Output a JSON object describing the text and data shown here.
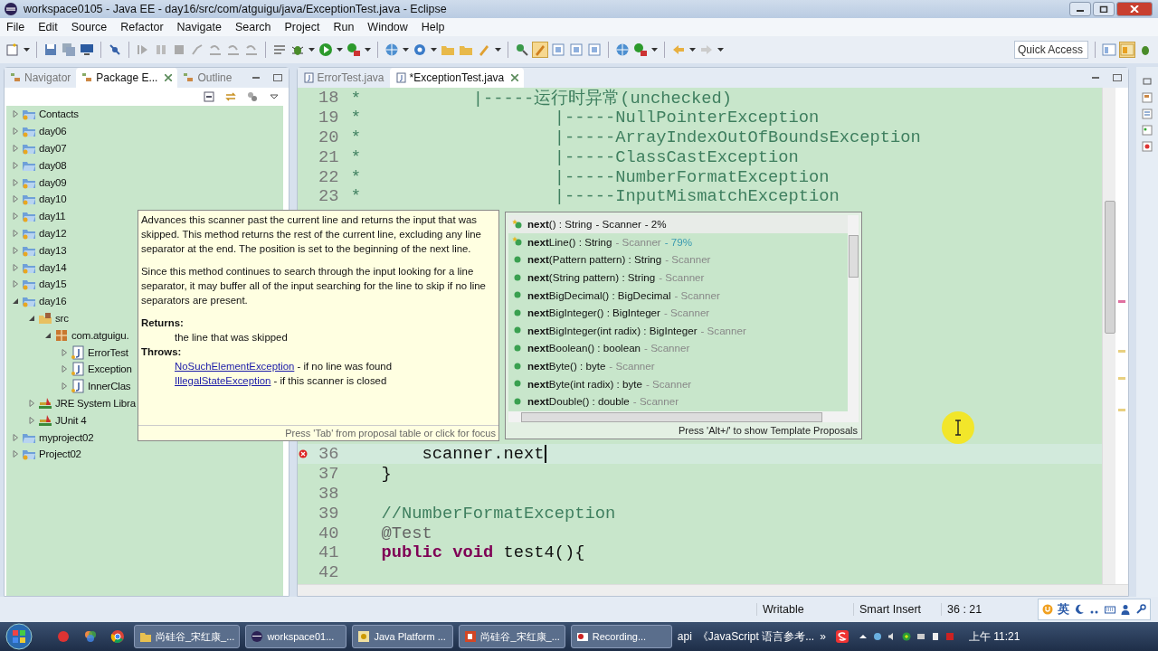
{
  "window": {
    "title": "workspace0105 - Java EE - day16/src/com/atguigu/java/ExceptionTest.java - Eclipse"
  },
  "menu": [
    "File",
    "Edit",
    "Source",
    "Refactor",
    "Navigate",
    "Search",
    "Project",
    "Run",
    "Window",
    "Help"
  ],
  "quick_access": {
    "placeholder": "Quick Access"
  },
  "left_panel": {
    "tabs": [
      {
        "label": "Navigator",
        "selected": false,
        "closable": false
      },
      {
        "label": "Package E...",
        "selected": true,
        "closable": true
      },
      {
        "label": "Outline",
        "selected": false,
        "closable": false
      }
    ],
    "tree": [
      {
        "label": "Contacts",
        "kind": "project",
        "expanded": false
      },
      {
        "label": "day06",
        "kind": "project",
        "expanded": false
      },
      {
        "label": "day07",
        "kind": "project",
        "expanded": false
      },
      {
        "label": "day08",
        "kind": "folder",
        "expanded": false
      },
      {
        "label": "day09",
        "kind": "project",
        "expanded": false
      },
      {
        "label": "day10",
        "kind": "project",
        "expanded": false
      },
      {
        "label": "day11",
        "kind": "project",
        "expanded": false
      },
      {
        "label": "day12",
        "kind": "project",
        "expanded": false
      },
      {
        "label": "day13",
        "kind": "project",
        "expanded": false
      },
      {
        "label": "day14",
        "kind": "project",
        "expanded": false
      },
      {
        "label": "day15",
        "kind": "project",
        "expanded": false
      },
      {
        "label": "day16",
        "kind": "project",
        "expanded": true,
        "children": [
          {
            "label": "src",
            "kind": "source",
            "expanded": true,
            "children": [
              {
                "label": "com.atguigu.",
                "kind": "package",
                "expanded": true,
                "children": [
                  {
                    "label": "ErrorTest",
                    "kind": "java",
                    "expanded": false
                  },
                  {
                    "label": "Exception",
                    "kind": "java",
                    "expanded": false
                  },
                  {
                    "label": "InnerClas",
                    "kind": "java",
                    "expanded": false
                  }
                ]
              }
            ]
          },
          {
            "label": "JRE System Libra",
            "kind": "library",
            "expanded": false
          },
          {
            "label": "JUnit 4",
            "kind": "library",
            "expanded": false
          }
        ]
      },
      {
        "label": "myproject02",
        "kind": "folder",
        "expanded": false
      },
      {
        "label": "Project02",
        "kind": "project",
        "expanded": false
      }
    ]
  },
  "editor": {
    "tabs": [
      {
        "label": "ErrorTest.java",
        "selected": false,
        "closable": false
      },
      {
        "label": "*ExceptionTest.java",
        "selected": true,
        "closable": true
      }
    ],
    "lines_top": [
      {
        "number": "18",
        "error": false,
        "tokens": [
          {
            "text": " *           |-----运行时异常(unchecked)",
            "kind": "comment"
          }
        ]
      },
      {
        "number": "19",
        "error": false,
        "tokens": [
          {
            "text": " *                   |-----NullPointerException",
            "kind": "comment"
          }
        ]
      },
      {
        "number": "20",
        "error": false,
        "tokens": [
          {
            "text": " *                   |-----ArrayIndexOutOfBoundsException",
            "kind": "comment"
          }
        ]
      },
      {
        "number": "21",
        "error": false,
        "tokens": [
          {
            "text": " *                   |-----ClassCastException",
            "kind": "comment"
          }
        ]
      },
      {
        "number": "22",
        "error": false,
        "tokens": [
          {
            "text": " *                   |-----NumberFormatException",
            "kind": "comment"
          }
        ]
      },
      {
        "number": "23",
        "error": false,
        "tokens": [
          {
            "text": " *                   |-----InputMismatchException",
            "kind": "comment"
          }
        ]
      }
    ],
    "lines_bottom": [
      {
        "number": "36",
        "error": true,
        "tokens": [
          {
            "text": "        scanner.next",
            "kind": "plain"
          }
        ]
      },
      {
        "number": "37",
        "error": false,
        "tokens": [
          {
            "text": "    }",
            "kind": "plain"
          }
        ]
      },
      {
        "number": "38",
        "error": false
      },
      {
        "number": "39",
        "error": false,
        "tokens": [
          {
            "text": "    //NumberFormatException",
            "kind": "comment"
          }
        ]
      },
      {
        "number": "40",
        "error": false,
        "tokens": [
          {
            "text": "    @Test",
            "kind": "annotation"
          }
        ]
      },
      {
        "number": "41",
        "error": false,
        "tokens": [
          {
            "text": "    public",
            "kind": "keyword"
          },
          {
            "text": " void",
            "kind": "keyword"
          },
          {
            "text": " test4(){",
            "kind": "plain"
          }
        ]
      },
      {
        "number": "42",
        "error": false
      }
    ]
  },
  "javadoc": {
    "paragraphs": [
      "Advances this scanner past the current line and returns the input that was skipped. This method returns the rest of the current line, excluding any line separator at the end. The position is set to the beginning of the next line.",
      "Since this method continues to search through the input looking for a line separator, it may buffer all of the input searching for the line to skip if no line separators are present."
    ],
    "returns_label": "Returns:",
    "returns": "the line that was skipped",
    "throws_label": "Throws:",
    "throws": [
      {
        "link": "NoSuchElementException",
        "text": " - if no line was found"
      },
      {
        "link": "IllegalStateException",
        "text": " - if this scanner is closed"
      }
    ],
    "footer": "Press 'Tab' from proposal table or click for focus"
  },
  "proposals": {
    "items": [
      {
        "signature": "**next**() : String",
        "owner": "- Scanner",
        "relevance": "- 2%",
        "kind": "starred",
        "selected": true
      },
      {
        "signature": "**next**Line() : String",
        "owner": "- Scanner",
        "relevance": "- 79%",
        "kind": "starred",
        "selected": false
      },
      {
        "signature": "**next**(Pattern pattern) : String",
        "owner": "- Scanner",
        "kind": "method",
        "selected": false
      },
      {
        "signature": "**next**(String pattern) : String",
        "owner": "- Scanner",
        "kind": "method",
        "selected": false
      },
      {
        "signature": "**next**BigDecimal() : BigDecimal",
        "owner": "- Scanner",
        "kind": "method",
        "selected": false
      },
      {
        "signature": "**next**BigInteger() : BigInteger",
        "owner": "- Scanner",
        "kind": "method",
        "selected": false
      },
      {
        "signature": "**next**BigInteger(int radix) : BigInteger",
        "owner": "- Scanner",
        "kind": "method",
        "selected": false
      },
      {
        "signature": "**next**Boolean() : boolean",
        "owner": "- Scanner",
        "kind": "method",
        "selected": false
      },
      {
        "signature": "**next**Byte() : byte",
        "owner": "- Scanner",
        "kind": "method",
        "selected": false
      },
      {
        "signature": "**next**Byte(int radix) : byte",
        "owner": "- Scanner",
        "kind": "method",
        "selected": false
      },
      {
        "signature": "**next**Double() : double",
        "owner": "- Scanner",
        "kind": "method",
        "selected": false
      }
    ],
    "footer": "Press 'Alt+/' to show Template Proposals"
  },
  "status_bar": {
    "mode": "Writable",
    "insert": "Smart Insert",
    "position": "36 : 21"
  },
  "ime": {
    "label": "英"
  },
  "taskbar": {
    "tasks": [
      {
        "label": "尚硅谷_宋红康_...",
        "kind": "folder"
      },
      {
        "label": "workspace01...",
        "kind": "eclipse"
      },
      {
        "label": "Java Platform ...",
        "kind": "help"
      },
      {
        "label": "尚硅谷_宋红康_...",
        "kind": "slides"
      },
      {
        "label": "Recording...",
        "kind": "record"
      }
    ],
    "extras": [
      "api",
      "《JavaScript 语言参考..."
    ],
    "overflow": "»",
    "clock": "上午 11:21"
  }
}
